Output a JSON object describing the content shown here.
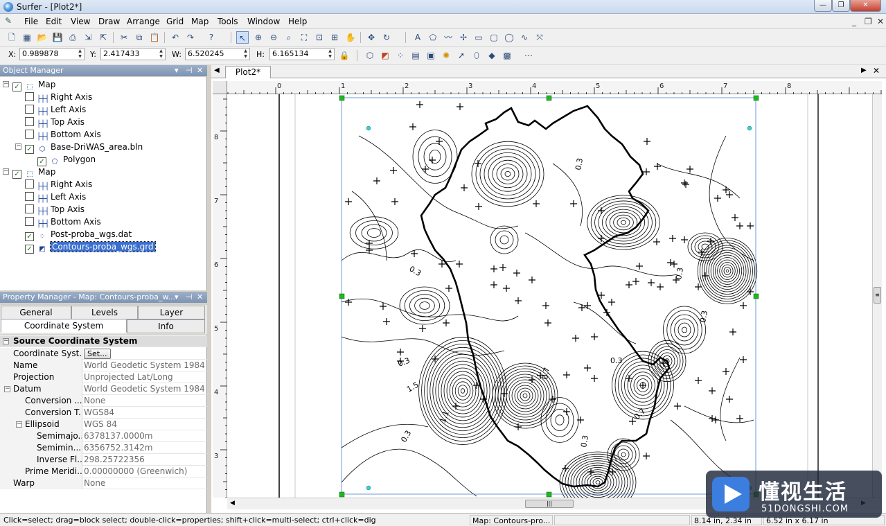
{
  "window": {
    "title": "Surfer - [Plot2*]",
    "minimize": "—",
    "restore": "❐",
    "close": "✕"
  },
  "menu": {
    "items": [
      "File",
      "Edit",
      "View",
      "Draw",
      "Arrange",
      "Grid",
      "Map",
      "Tools",
      "Window",
      "Help"
    ],
    "mdi_min": "_",
    "mdi_restore": "❐",
    "mdi_close": "✕"
  },
  "coords": {
    "x_label": "X:",
    "x": "0.989878",
    "y_label": "Y:",
    "y": "2.417433",
    "w_label": "W:",
    "w": "6.520245",
    "h_label": "H:",
    "h": "6.165134"
  },
  "object_manager": {
    "title": "Object Manager",
    "rows": [
      {
        "label": "Map",
        "checked": true,
        "icon": "map-frame-icon"
      },
      {
        "label": "Right Axis",
        "checked": false,
        "icon": "axis-icon"
      },
      {
        "label": "Left Axis",
        "checked": false,
        "icon": "axis-icon"
      },
      {
        "label": "Top Axis",
        "checked": false,
        "icon": "axis-icon"
      },
      {
        "label": "Bottom Axis",
        "checked": false,
        "icon": "axis-icon"
      },
      {
        "label": "Base-DriWAS_area.bln",
        "checked": true,
        "icon": "base-map-icon"
      },
      {
        "label": "Polygon",
        "checked": true,
        "icon": "polygon-icon"
      },
      {
        "label": "Map",
        "checked": true,
        "icon": "map-frame-icon"
      },
      {
        "label": "Right Axis",
        "checked": false,
        "icon": "axis-icon"
      },
      {
        "label": "Left Axis",
        "checked": false,
        "icon": "axis-icon"
      },
      {
        "label": "Top Axis",
        "checked": false,
        "icon": "axis-icon"
      },
      {
        "label": "Bottom Axis",
        "checked": false,
        "icon": "axis-icon"
      },
      {
        "label": "Post-proba_wgs.dat",
        "checked": true,
        "icon": "post-map-icon"
      },
      {
        "label": "Contours-proba_wgs.grd",
        "checked": true,
        "icon": "contour-map-icon",
        "selected": true
      }
    ]
  },
  "property_manager": {
    "title": "Property Manager - Map: Contours-proba_w...",
    "tabs": [
      "General",
      "Levels",
      "Layer",
      "Coordinate System",
      "Info"
    ],
    "section": "Source Coordinate System",
    "set_button": "Set...",
    "rows": [
      {
        "key": "Coordinate Syst...",
        "value": ""
      },
      {
        "key": "Name",
        "value": "World Geodetic System 1984"
      },
      {
        "key": "Projection",
        "value": "Unprojected Lat/Long"
      },
      {
        "key": "Datum",
        "value": "World Geodetic System 1984"
      },
      {
        "key": "Conversion ...",
        "value": "None"
      },
      {
        "key": "Conversion T...",
        "value": "WGS84"
      },
      {
        "key": "Ellipsoid",
        "value": "WGS 84"
      },
      {
        "key": "Semimajo...",
        "value": "6378137.0000m"
      },
      {
        "key": "Semimin...",
        "value": "6356752.3142m"
      },
      {
        "key": "Inverse Fl...",
        "value": "298.25722356"
      },
      {
        "key": "Prime Meridi...",
        "value": "0.00000000 (Greenwich)"
      },
      {
        "key": "Warp",
        "value": "None"
      }
    ]
  },
  "document": {
    "tab": "Plot2*"
  },
  "ruler": {
    "h": [
      "0",
      "1",
      "2",
      "3",
      "4",
      "5",
      "6",
      "7",
      "8"
    ],
    "v": [
      "8",
      "7",
      "6",
      "5",
      "4",
      "3"
    ]
  },
  "contour_labels": [
    "0.3",
    "0.3",
    "0.3",
    "0.3",
    "0.3",
    "0.3",
    "0.7",
    "1.5",
    "1.1",
    "0.3",
    "0.3",
    "0.7"
  ],
  "status": {
    "hint": "Click=select; drag=block select; double-click=properties; shift+click=multi-select; ctrl+click=dig",
    "selection": "Map: Contours-pro...",
    "cursor": "8.14 in, 2.34 in",
    "size": "6.52 in x 6.17 in"
  },
  "watermark": {
    "text": "懂视生活",
    "url": "51DONGSHI.COM"
  }
}
